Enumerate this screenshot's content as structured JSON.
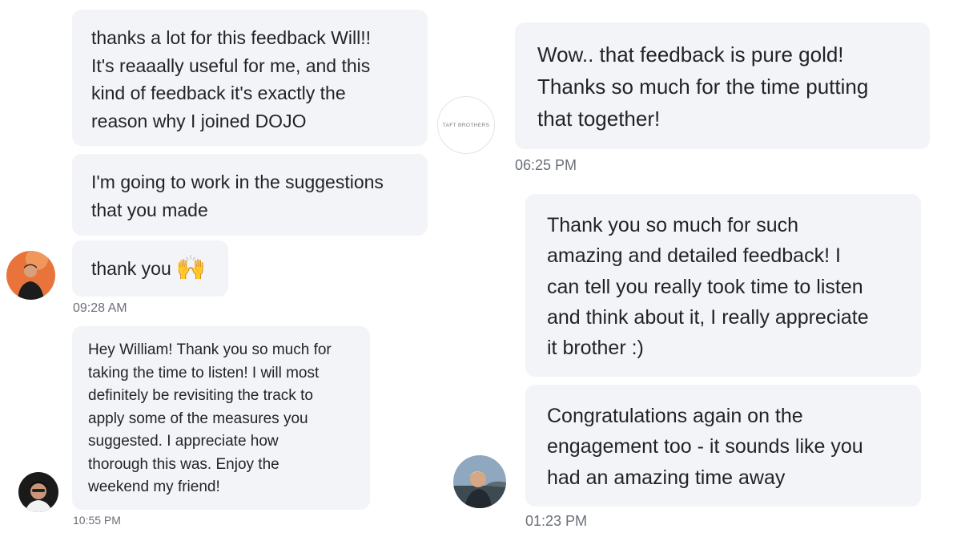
{
  "left": {
    "messages": [
      "thanks a lot for this feedback Will!!\nIt's reaaally useful for me, and this\nkind of feedback it's exactly the\nreason why I joined DOJO",
      "I'm going to work in the suggestions\nthat you made",
      "thank you",
      "Hey William! Thank you so much for\ntaking the time to listen! I will most\ndefinitely be revisiting the track to\napply some of the measures you\nsuggested. I appreciate how\nthorough this was. Enjoy the\nweekend my friend!"
    ],
    "emoji": "🙌",
    "times": [
      "09:28 AM",
      "10:55 PM"
    ]
  },
  "right": {
    "logo_text": "TAFT BROTHERS",
    "messages": [
      "Wow.. that feedback is pure gold!\nThanks so much for the time putting\nthat together!",
      "Thank you so much for such\namazing and detailed feedback! I\ncan tell you really took time to listen\nand think about it, I really appreciate\nit brother :)",
      "Congratulations again on the\nengagement too - it sounds like you\nhad an amazing time away"
    ],
    "times": [
      "06:25 PM",
      "01:23 PM"
    ]
  },
  "colors": {
    "bubble": "#f3f4f8",
    "timestamp": "#6b6f78",
    "avatar_orange": "#e8743b"
  }
}
